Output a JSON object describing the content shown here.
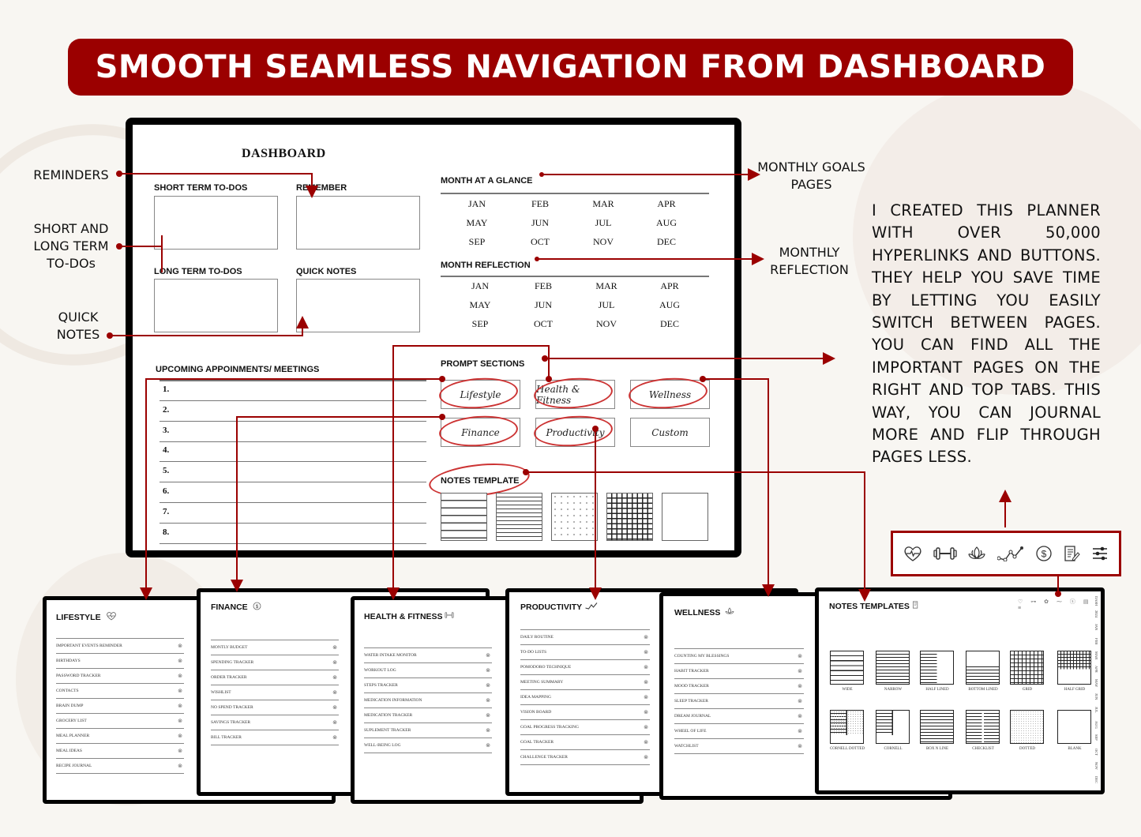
{
  "banner": {
    "title": "SMOOTH SEAMLESS NAVIGATION FROM DASHBOARD"
  },
  "colors": {
    "accent": "#9b0000",
    "background": "#f8f6f2",
    "frame": "#000000"
  },
  "callouts": {
    "reminders": "REMINDERS",
    "todos": [
      "SHORT AND",
      "LONG TERM",
      "TO-DOs"
    ],
    "quick_notes": [
      "QUICK",
      "NOTES"
    ],
    "monthly_goals": [
      "MONTHLY GOALS",
      "PAGES"
    ],
    "monthly_reflection": [
      "MONTHLY",
      "REFLECTION"
    ]
  },
  "description": "I CREATED THIS PLANNER WITH OVER 50,000 HYPERLINKS AND BUTTONS. THEY HELP YOU SAVE TIME BY LETTING YOU EASILY SWITCH BETWEEN PAGES. YOU CAN FIND ALL THE IMPORTANT PAGES ON THE RIGHT AND TOP TABS. THIS WAY, YOU CAN JOURNAL MORE AND FLIP THROUGH PAGES LESS.",
  "dashboard": {
    "title": "DASHBOARD",
    "short_term": "SHORT TERM TO-DOS",
    "remember": "REMEMBER",
    "long_term": "LONG TERM TO-DOS",
    "quick_notes": "QUICK NOTES",
    "appointments_title": "UPCOMING APPOINMENTS/ MEETINGS",
    "appointments": [
      "1.",
      "2.",
      "3.",
      "4.",
      "5.",
      "6.",
      "7.",
      "8."
    ],
    "month_glance_title": "MONTH AT A GLANCE",
    "month_reflection_title": "MONTH REFLECTION",
    "months": [
      "JAN",
      "FEB",
      "MAR",
      "APR",
      "MAY",
      "JUN",
      "JUL",
      "AUG",
      "SEP",
      "OCT",
      "NOV",
      "DEC"
    ],
    "prompt_title": "PROMPT SECTIONS",
    "prompts": [
      "Lifestyle",
      "Health & Fitness",
      "Wellness",
      "Finance",
      "Productivity",
      "Custom"
    ],
    "notes_title": "NOTES TEMPLATE",
    "note_templates": [
      "wide-lined",
      "narrow-lined",
      "dotted",
      "grid",
      "blank"
    ]
  },
  "icon_bar": [
    "heart-pulse-icon",
    "dumbbell-icon",
    "lotus-icon",
    "trend-line-icon",
    "dollar-icon",
    "notes-edit-icon",
    "sliders-icon"
  ],
  "pages": {
    "lifestyle": {
      "title": "LIFESTYLE",
      "icon": "heart-pulse-icon",
      "items": [
        "IMPORTANT EVENTS REMINDER",
        "BIRTHDAYS",
        "PASSWORD TRACKER",
        "CONTACTS",
        "BRAIN DUMP",
        "GROCERY LIST",
        "MEAL PLANNER",
        "MEAL IDEAS",
        "RECIPE JOURNAL"
      ]
    },
    "finance": {
      "title": "FINANCE",
      "icon": "dollar-icon",
      "items": [
        "MONTLY BUDGET",
        "SPENDING TRACKER",
        "ORDER TRACKER",
        "WISHLIST",
        "NO SPEND TRACKER",
        "SAVINGS TRACKER",
        "BILL TRACKER"
      ]
    },
    "health": {
      "title": "HEALTH & FITNESS",
      "icon": "dumbbell-icon",
      "items": [
        "WATER INTAKE MONITOR",
        "WORKOUT LOG",
        "STEPS TRACKER",
        "MEDICATION INFORMATION",
        "MEDICATION TRACKER",
        "SUPLEMENT TRACKER",
        "WELL-BEING LOG"
      ]
    },
    "productivity": {
      "title": "PRODUCTIVITY",
      "icon": "trend-line-icon",
      "items": [
        "DAILY ROUTINE",
        "TO-DO LISTS",
        "POMODORO TECHNIQUE",
        "MEETING SUMMARY",
        "IDEA MAPPING",
        "VISION BOARD",
        "GOAL PROGRESS TRACKING",
        "GOAL TRACKER",
        "CHALLENGE TRACKER"
      ]
    },
    "wellness": {
      "title": "WELLNESS",
      "icon": "lotus-icon",
      "items": [
        "COUNTING MY BLESSINGS",
        "HABIT TRACKER",
        "MOOD TRACKER",
        "SLEEP TRACKER",
        "DREAM JOURNAL",
        "WHEEL OF LIFE",
        "WATCHLIST"
      ]
    },
    "notes": {
      "title": "NOTES TEMPLATES",
      "icon": "notes-edit-icon",
      "templates": [
        "WIDE",
        "NARROW",
        "HALF LINED",
        "BOTTOM LINED",
        "GRID",
        "HALF GRID",
        "CORNELL DOTTED",
        "CORNELL",
        "BOX N LINE",
        "CHECKLIST",
        "DOTTED",
        "BLANK"
      ],
      "side_tabs": [
        "DASH",
        "2024",
        "JAN",
        "FEB",
        "MAR",
        "APR",
        "MAY",
        "JUN",
        "JUL",
        "AUG",
        "SEP",
        "OCT",
        "NOV",
        "DEC"
      ]
    }
  },
  "item_link_glyph": "⊗"
}
